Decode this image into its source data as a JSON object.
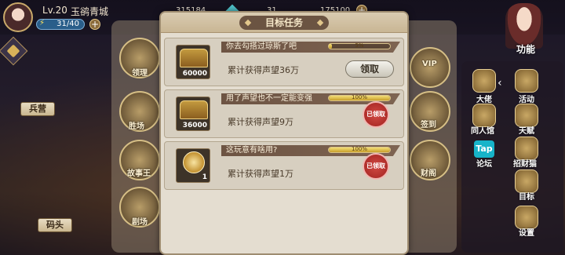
{
  "player": {
    "level": "Lv.20",
    "name": "玉鹆青城",
    "energy": "31/40"
  },
  "resources": [
    "315184",
    "31",
    "175100"
  ],
  "left_labels": [
    "兵营",
    "码头"
  ],
  "background_buildings": [
    "领理",
    "VIP",
    "胜场",
    "签到",
    "故事王",
    "剧场",
    "财阁"
  ],
  "right_panel": {
    "function_label": "功能",
    "items": [
      {
        "label": "大佬",
        "icon": "boss-icon"
      },
      {
        "label": "活动",
        "icon": "activity-icon"
      },
      {
        "label": "同人馆",
        "icon": "fanart-icon"
      },
      {
        "label": "天赋",
        "icon": "talent-icon"
      },
      {
        "label": "论坛",
        "icon": "tap-forum-icon"
      },
      {
        "label": "招财猫",
        "icon": "lucky-cat-icon"
      },
      {
        "label": "目标",
        "icon": "target-icon"
      },
      {
        "label": "设置",
        "icon": "settings-icon"
      }
    ],
    "tap_text": "Tap"
  },
  "dialog": {
    "title": "目标任务",
    "quests": [
      {
        "title": "你去勾搭过琼斯了吧",
        "description": "累计获得声望36万",
        "reward_count": "60000",
        "reward_icon": "treasure-chest-icon",
        "progress_text": "5%",
        "progress": 0.05,
        "action": "领取",
        "claimed": false
      },
      {
        "title": "用了声望也不一定能变强",
        "description": "累计获得声望9万",
        "reward_count": "36000",
        "reward_icon": "treasure-chest-icon",
        "progress_text": "100%",
        "progress": 1.0,
        "action": "已领取",
        "claimed": true
      },
      {
        "title": "这玩意有啥用?",
        "description": "累计获得声望1万",
        "reward_count": "1",
        "reward_icon": "gold-badge-icon",
        "progress_text": "100%",
        "progress": 1.0,
        "action": "已领取",
        "claimed": true
      }
    ]
  }
}
